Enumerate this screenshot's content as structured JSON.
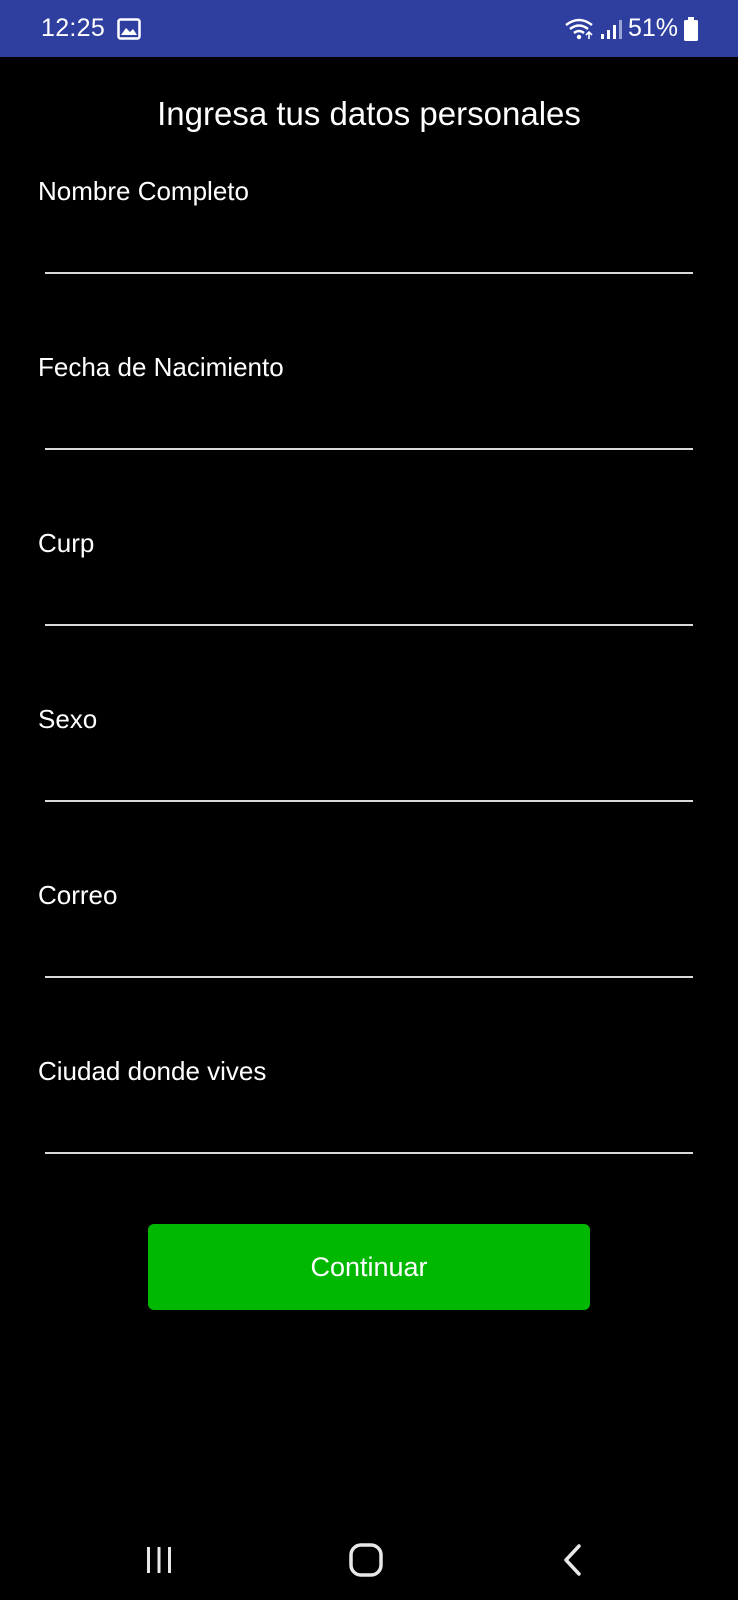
{
  "status_bar": {
    "time": "12:25",
    "battery": "51%",
    "icons": [
      "gallery-icon",
      "wifi-icon",
      "signal-icon",
      "battery-icon"
    ]
  },
  "form": {
    "title": "Ingresa tus datos personales",
    "fields": [
      {
        "label": "Nombre Completo",
        "value": ""
      },
      {
        "label": "Fecha de Nacimiento",
        "value": ""
      },
      {
        "label": "Curp",
        "value": ""
      },
      {
        "label": "Sexo",
        "value": ""
      },
      {
        "label": "Correo",
        "value": ""
      },
      {
        "label": "Ciudad donde vives",
        "value": ""
      }
    ],
    "continue_label": "Continuar"
  },
  "nav_bar": {
    "icons": [
      "recent-apps-icon",
      "home-icon",
      "back-icon"
    ]
  },
  "colors": {
    "status_bar": "#2f3fa0",
    "background": "#000000",
    "button": "#00b800",
    "underline": "#d9d9d9"
  }
}
